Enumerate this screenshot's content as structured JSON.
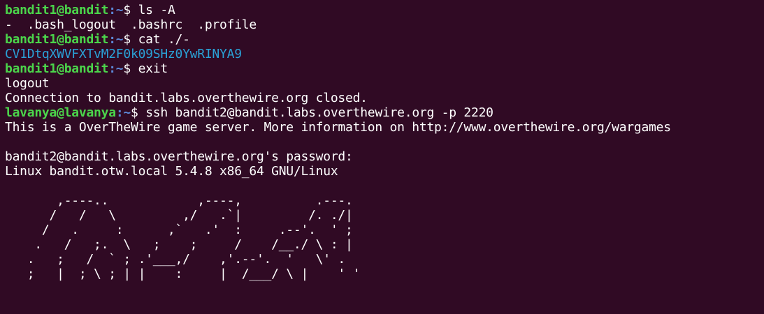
{
  "terminal": {
    "background": "#300a24",
    "colors": {
      "prompt_user": "#4bd54b",
      "prompt_path": "#5c87d6",
      "text": "#ffffff",
      "highlight": "#2aa1d6"
    },
    "lines": [
      {
        "user": "bandit1@bandit",
        "path": ":~",
        "sym": "$ ",
        "cmd": "ls -A"
      },
      {
        "text": "-  .bash_logout  .bashrc  .profile"
      },
      {
        "user": "bandit1@bandit",
        "path": ":~",
        "sym": "$ ",
        "cmd": "cat ./-"
      },
      {
        "cyan": "CV1DtqXWVFXTvM2F0k09SHz0YwRINYA9"
      },
      {
        "user": "bandit1@bandit",
        "path": ":~",
        "sym": "$ ",
        "cmd": "exit"
      },
      {
        "text": "logout"
      },
      {
        "text": "Connection to bandit.labs.overthewire.org closed."
      },
      {
        "user": "lavanya@lavanya",
        "path": ":~",
        "sym": "$ ",
        "cmd": "ssh bandit2@bandit.labs.overthewire.org -p 2220"
      },
      {
        "text": "This is a OverTheWire game server. More information on http://www.overthewire.org/wargames"
      },
      {
        "text": ""
      },
      {
        "text": "bandit2@bandit.labs.overthewire.org's password:"
      },
      {
        "text": "Linux bandit.otw.local 5.4.8 x86_64 GNU/Linux"
      },
      {
        "text": ""
      },
      {
        "art": "       ,----..            ,----,          .---."
      },
      {
        "art": "      /   /   \\         ,/   .`|         /. ./|"
      },
      {
        "art": "     /   .     :      ,`   .'  :     .--'.  ' ;"
      },
      {
        "art": "    .   /   ;.  \\   ;    ;     /    /__./ \\ : |"
      },
      {
        "art": "   .   ;   /  ` ; .'___,/    ,'.--'.  '   \\' ."
      },
      {
        "art": "   ;   |  ; \\ ; | |    :     |  /___/ \\ |    ' '"
      }
    ]
  }
}
